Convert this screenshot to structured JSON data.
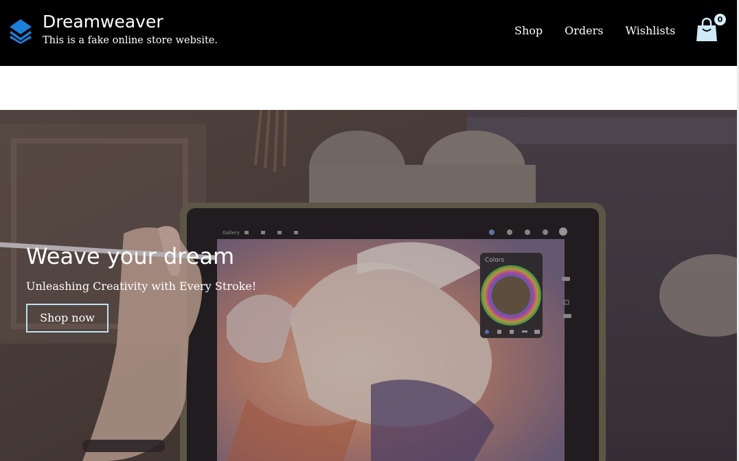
{
  "header": {
    "brand_name": "Dreamweaver",
    "tagline": "This is a fake online store website.",
    "nav": [
      {
        "label": "Shop"
      },
      {
        "label": "Orders"
      },
      {
        "label": "Wishlists"
      }
    ],
    "cart_count": "0",
    "logo_icon": "layers-icon",
    "cart_icon": "shopping-bag-icon"
  },
  "hero": {
    "title": "Weave your dream",
    "subtitle": "Unleashing Creativity with Every Stroke!",
    "button_label": "Shop now",
    "tablet_app": {
      "gallery_label": "Gallery",
      "colors_panel_label": "Colors"
    }
  },
  "colors": {
    "header_bg": "#000000",
    "logo_blue": "#1e7fd9",
    "button_border": "#bde3f2",
    "cart_icon": "#cfe9f7"
  }
}
